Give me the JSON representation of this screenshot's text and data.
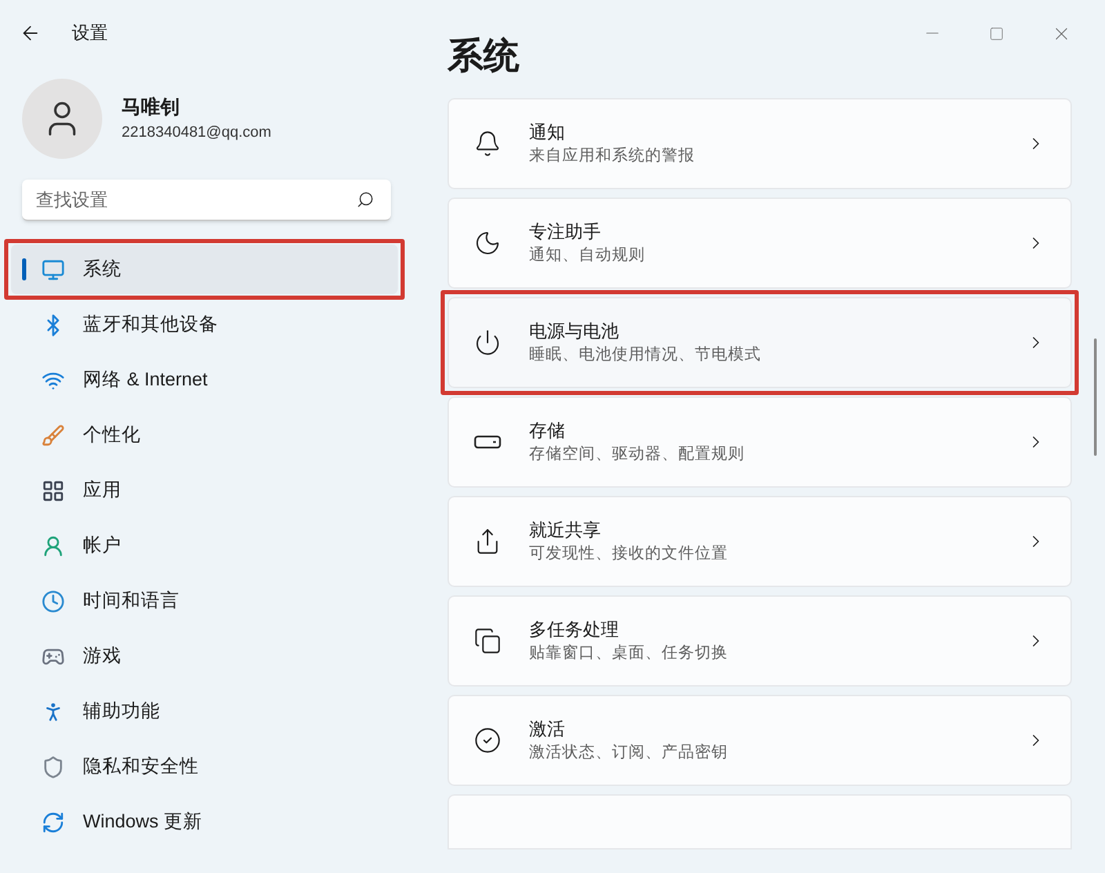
{
  "window": {
    "title": "设置"
  },
  "profile": {
    "name": "马唯钊",
    "email": "2218340481@qq.com"
  },
  "search": {
    "placeholder": "查找设置"
  },
  "sidebar": {
    "items": [
      {
        "label": "系统",
        "selected": true,
        "annotated": true
      },
      {
        "label": "蓝牙和其他设备",
        "selected": false,
        "annotated": false
      },
      {
        "label": "网络 & Internet",
        "selected": false,
        "annotated": false
      },
      {
        "label": "个性化",
        "selected": false,
        "annotated": false
      },
      {
        "label": "应用",
        "selected": false,
        "annotated": false
      },
      {
        "label": "帐户",
        "selected": false,
        "annotated": false
      },
      {
        "label": "时间和语言",
        "selected": false,
        "annotated": false
      },
      {
        "label": "游戏",
        "selected": false,
        "annotated": false
      },
      {
        "label": "辅助功能",
        "selected": false,
        "annotated": false
      },
      {
        "label": "隐私和安全性",
        "selected": false,
        "annotated": false
      },
      {
        "label": "Windows 更新",
        "selected": false,
        "annotated": false
      }
    ]
  },
  "page": {
    "title": "系统"
  },
  "cards": [
    {
      "title": "通知",
      "subtitle": "来自应用和系统的警报",
      "annotated": false
    },
    {
      "title": "专注助手",
      "subtitle": "通知、自动规则",
      "annotated": false
    },
    {
      "title": "电源与电池",
      "subtitle": "睡眠、电池使用情况、节电模式",
      "annotated": true
    },
    {
      "title": "存储",
      "subtitle": "存储空间、驱动器、配置规则",
      "annotated": false
    },
    {
      "title": "就近共享",
      "subtitle": "可发现性、接收的文件位置",
      "annotated": false
    },
    {
      "title": "多任务处理",
      "subtitle": "贴靠窗口、桌面、任务切换",
      "annotated": false
    },
    {
      "title": "激活",
      "subtitle": "激活状态、订阅、产品密钥",
      "annotated": false
    }
  ]
}
